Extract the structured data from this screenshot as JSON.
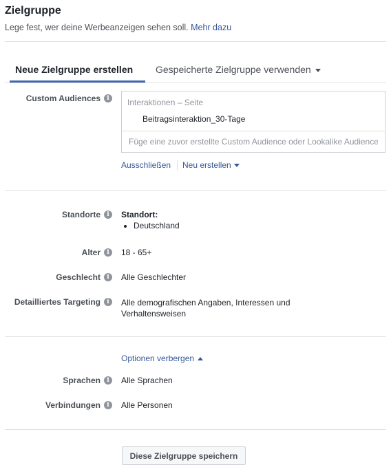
{
  "header": {
    "title": "Zielgruppe",
    "subtitle": "Lege fest, wer deine Werbeanzeigen sehen soll.",
    "learn_more": "Mehr dazu"
  },
  "tabs": [
    {
      "label": "Neue Zielgruppe erstellen",
      "active": true
    },
    {
      "label": "Gespeicherte Zielgruppe verwenden",
      "active": false
    }
  ],
  "custom_audiences": {
    "label": "Custom Audiences",
    "group_label": "Interaktionen – Seite",
    "selected_item": "Beitragsinteraktion_30-Tage",
    "input_placeholder": "Füge eine zuvor erstellte Custom Audience oder Lookalike Audience",
    "exclude_link": "Ausschließen",
    "create_new_link": "Neu erstellen"
  },
  "targeting": {
    "locations_label": "Standorte",
    "location_heading": "Standort:",
    "location_items": [
      "Deutschland"
    ],
    "age_label": "Alter",
    "age_value": "18 - 65+",
    "gender_label": "Geschlecht",
    "gender_value": "Alle Geschlechter",
    "detailed_label": "Detailliertes Targeting",
    "detailed_value": "Alle demografischen Angaben, Interessen und Verhaltensweisen"
  },
  "options": {
    "toggle_label": "Optionen verbergen",
    "languages_label": "Sprachen",
    "languages_value": "Alle Sprachen",
    "connections_label": "Verbindungen",
    "connections_value": "Alle Personen"
  },
  "footer": {
    "save_button": "Diese Zielgruppe speichern"
  },
  "colors": {
    "accent": "#4267b2",
    "link": "#365899",
    "divider": "#dddfe2"
  }
}
